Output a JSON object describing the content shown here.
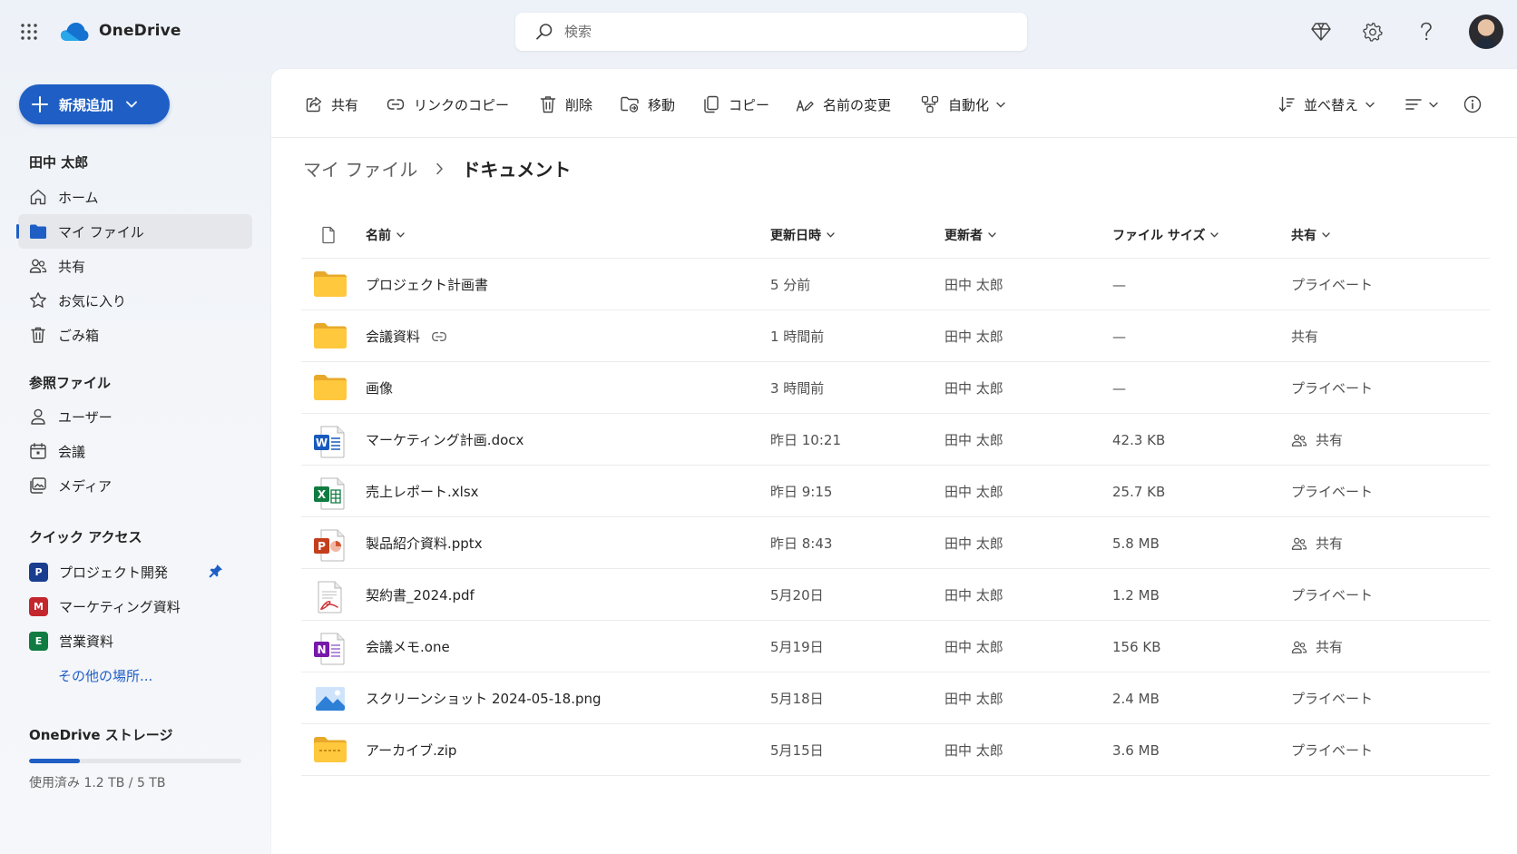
{
  "app": {
    "name": "OneDrive"
  },
  "search": {
    "placeholder": "検索"
  },
  "sidebar": {
    "new_button": "新規追加",
    "user_name": "田中 太郎",
    "nav": [
      {
        "label": "ホーム",
        "icon": "home-icon"
      },
      {
        "label": "マイ ファイル",
        "icon": "folder-icon",
        "active": true
      },
      {
        "label": "共有",
        "icon": "people-icon"
      },
      {
        "label": "お気に入り",
        "icon": "star-icon"
      },
      {
        "label": "ごみ箱",
        "icon": "trash-icon"
      }
    ],
    "browse_heading": "参照ファイル",
    "browse": [
      {
        "label": "ユーザー",
        "icon": "person-icon"
      },
      {
        "label": "会議",
        "icon": "calendar-icon"
      },
      {
        "label": "メディア",
        "icon": "media-icon"
      }
    ],
    "quick_heading": "クイック アクセス",
    "quick": [
      {
        "label": "プロジェクト開発",
        "badge": "P",
        "color": "#1a3e8f",
        "pinned": true
      },
      {
        "label": "マーケティング資料",
        "badge": "M",
        "color": "#c4262e"
      },
      {
        "label": "営業資料",
        "badge": "E",
        "color": "#107c41"
      }
    ],
    "more_places": "その他の場所...",
    "storage": {
      "title": "OneDrive ストレージ",
      "used_text": "使用済み 1.2 TB / 5 TB",
      "used_fraction": 0.24
    }
  },
  "toolbar": {
    "share": "共有",
    "copy_link": "リンクのコピー",
    "delete": "削除",
    "move": "移動",
    "copy": "コピー",
    "rename": "名前の変更",
    "automate": "自動化",
    "sort": "並べ替え"
  },
  "breadcrumb": {
    "parent": "マイ ファイル",
    "current": "ドキュメント"
  },
  "columns": {
    "name": "名前",
    "modified": "更新日時",
    "modified_by": "更新者",
    "size": "ファイル サイズ",
    "sharing": "共有"
  },
  "files": [
    {
      "name": "プロジェクト計画書",
      "type": "folder",
      "modified": "5 分前",
      "by": "田中 太郎",
      "size": "—",
      "sharing": "プライベート",
      "shared_icon": false,
      "link": false
    },
    {
      "name": "会議資料",
      "type": "folder",
      "modified": "1 時間前",
      "by": "田中 太郎",
      "size": "—",
      "sharing": "共有",
      "shared_icon": false,
      "link": true
    },
    {
      "name": "画像",
      "type": "folder",
      "modified": "3 時間前",
      "by": "田中 太郎",
      "size": "—",
      "sharing": "プライベート",
      "shared_icon": false,
      "link": false
    },
    {
      "name": "マーケティング計画.docx",
      "type": "word",
      "modified": "昨日 10:21",
      "by": "田中 太郎",
      "size": "42.3 KB",
      "sharing": "共有",
      "shared_icon": true,
      "link": false
    },
    {
      "name": "売上レポート.xlsx",
      "type": "excel",
      "modified": "昨日 9:15",
      "by": "田中 太郎",
      "size": "25.7 KB",
      "sharing": "プライベート",
      "shared_icon": false,
      "link": false
    },
    {
      "name": "製品紹介資料.pptx",
      "type": "powerpoint",
      "modified": "昨日 8:43",
      "by": "田中 太郎",
      "size": "5.8 MB",
      "sharing": "共有",
      "shared_icon": true,
      "link": false
    },
    {
      "name": "契約書_2024.pdf",
      "type": "pdf",
      "modified": "5月20日",
      "by": "田中 太郎",
      "size": "1.2 MB",
      "sharing": "プライベート",
      "shared_icon": false,
      "link": false
    },
    {
      "name": "会議メモ.one",
      "type": "onenote",
      "modified": "5月19日",
      "by": "田中 太郎",
      "size": "156 KB",
      "sharing": "共有",
      "shared_icon": true,
      "link": false
    },
    {
      "name": "スクリーンショット 2024-05-18.png",
      "type": "image",
      "modified": "5月18日",
      "by": "田中 太郎",
      "size": "2.4 MB",
      "sharing": "プライベート",
      "shared_icon": false,
      "link": false
    },
    {
      "name": "アーカイブ.zip",
      "type": "zip",
      "modified": "5月15日",
      "by": "田中 太郎",
      "size": "3.6 MB",
      "sharing": "プライベート",
      "shared_icon": false,
      "link": false
    }
  ]
}
